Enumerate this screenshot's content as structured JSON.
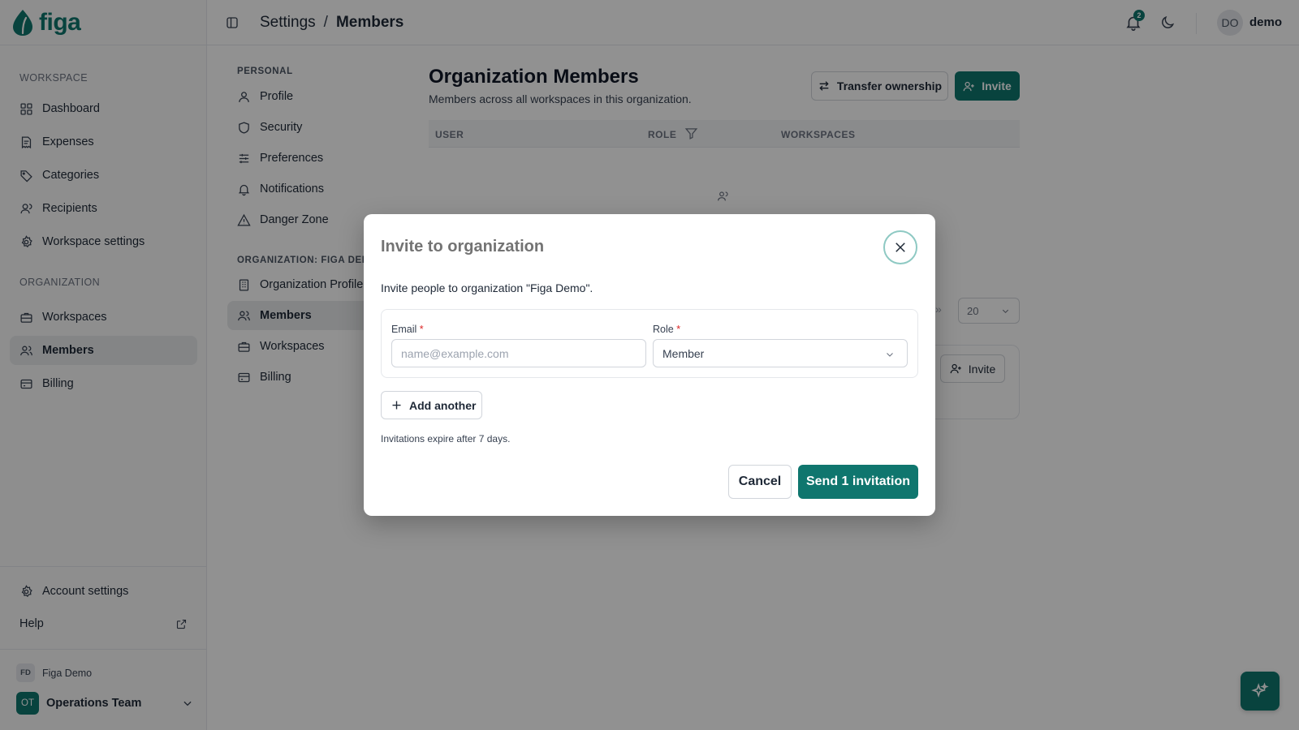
{
  "app": {
    "logo_text": "figa"
  },
  "header": {
    "breadcrumb_parent": "Settings",
    "breadcrumb_separator": "/",
    "breadcrumb_current": "Members",
    "notification_count": "2",
    "avatar_initials": "DO",
    "username": "demo"
  },
  "sidebar": {
    "workspace_section": "WORKSPACE",
    "workspace_items": [
      {
        "label": "Dashboard",
        "icon": "grid-icon"
      },
      {
        "label": "Expenses",
        "icon": "receipt-icon"
      },
      {
        "label": "Categories",
        "icon": "tag-icon"
      },
      {
        "label": "Recipients",
        "icon": "user-icon"
      },
      {
        "label": "Workspace settings",
        "icon": "gear-icon"
      }
    ],
    "organization_section": "ORGANIZATION",
    "organization_items": [
      {
        "label": "Workspaces",
        "icon": "briefcase-icon"
      },
      {
        "label": "Members",
        "icon": "users-icon",
        "active": true
      },
      {
        "label": "Billing",
        "icon": "credit-card-icon"
      }
    ],
    "account_settings": "Account settings",
    "help": "Help",
    "org_badge": "FD",
    "org_name": "Figa Demo",
    "workspace_badge": "OT",
    "workspace_name": "Operations Team"
  },
  "settings_nav": {
    "personal_section": "PERSONAL",
    "personal_items": [
      {
        "label": "Profile",
        "icon": "user-icon"
      },
      {
        "label": "Security",
        "icon": "shield-icon"
      },
      {
        "label": "Preferences",
        "icon": "sliders-icon"
      },
      {
        "label": "Notifications",
        "icon": "bell-icon"
      },
      {
        "label": "Danger Zone",
        "icon": "warning-icon"
      }
    ],
    "org_section": "ORGANIZATION: FIGA DEMO",
    "org_items": [
      {
        "label": "Organization Profile",
        "icon": "building-icon"
      },
      {
        "label": "Members",
        "icon": "users-icon",
        "active": true
      },
      {
        "label": "Workspaces",
        "icon": "briefcase-icon"
      },
      {
        "label": "Billing",
        "icon": "credit-card-icon"
      }
    ]
  },
  "main": {
    "title": "Organization Members",
    "subtitle": "Members across all workspaces in this organization.",
    "transfer_button": "Transfer ownership",
    "invite_button": "Invite",
    "columns": [
      "USER",
      "ROLE",
      "WORKSPACES"
    ],
    "page_size": "20",
    "pager_arrow": "»",
    "card_invite_button": "Invite"
  },
  "modal": {
    "title": "Invite to organization",
    "description": "Invite people to organization \"Figa Demo\".",
    "email_label": "Email",
    "email_placeholder": "name@example.com",
    "role_label": "Role",
    "role_value": "Member",
    "required_mark": "*",
    "add_another": "Add another",
    "expire_note": "Invitations expire after 7 days.",
    "cancel": "Cancel",
    "send": "Send 1 invitation"
  },
  "colors": {
    "accent": "#0f766e",
    "overlay": "rgba(0,0,0,0.43)"
  }
}
